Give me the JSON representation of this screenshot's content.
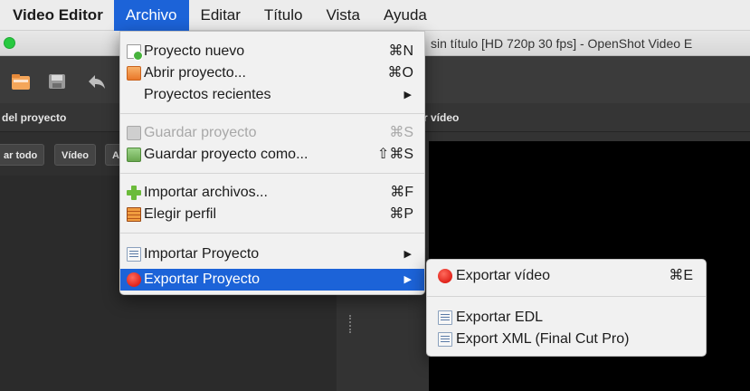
{
  "menubar": {
    "items": [
      "Video Editor",
      "Archivo",
      "Editar",
      "Título",
      "Vista",
      "Ayuda"
    ]
  },
  "window": {
    "title": "sin título [HD 720p 30 fps] - OpenShot Video E"
  },
  "panels": {
    "left_header": "del proyecto",
    "right_header": "r vídeo",
    "filters": [
      "ar todo",
      "Vídeo",
      "A"
    ]
  },
  "archivo_menu": {
    "items": [
      {
        "label": "Proyecto nuevo",
        "shortcut": "⌘N",
        "icon": "new-project-icon"
      },
      {
        "label": "Abrir proyecto...",
        "shortcut": "⌘O",
        "icon": "open-folder-icon"
      },
      {
        "label": "Proyectos recientes",
        "arrow": "▶"
      },
      {
        "label": "Guardar proyecto",
        "shortcut": "⌘S",
        "icon": "save-icon",
        "disabled": true
      },
      {
        "label": "Guardar proyecto como...",
        "shortcut": "⇧⌘S",
        "icon": "save-as-icon"
      },
      {
        "label": "Importar archivos...",
        "shortcut": "⌘F",
        "icon": "import-plus-icon"
      },
      {
        "label": "Elegir perfil",
        "shortcut": "⌘P",
        "icon": "profile-film-icon"
      },
      {
        "label": "Importar Proyecto",
        "arrow": "▶",
        "icon": "import-project-icon"
      },
      {
        "label": "Exportar Proyecto",
        "arrow": "▶",
        "icon": "export-red-icon",
        "highlighted": true
      }
    ]
  },
  "export_submenu": {
    "items": [
      {
        "label": "Exportar vídeo",
        "shortcut": "⌘E",
        "icon": "export-video-red-icon"
      },
      {
        "label": "Exportar EDL",
        "icon": "edl-list-icon"
      },
      {
        "label": "Export XML (Final Cut Pro)",
        "icon": "xml-list-icon"
      }
    ]
  },
  "colors": {
    "menu_highlight": "#1c63d8",
    "menubar_bg": "#ececec",
    "app_bg": "#2a2a2a"
  }
}
